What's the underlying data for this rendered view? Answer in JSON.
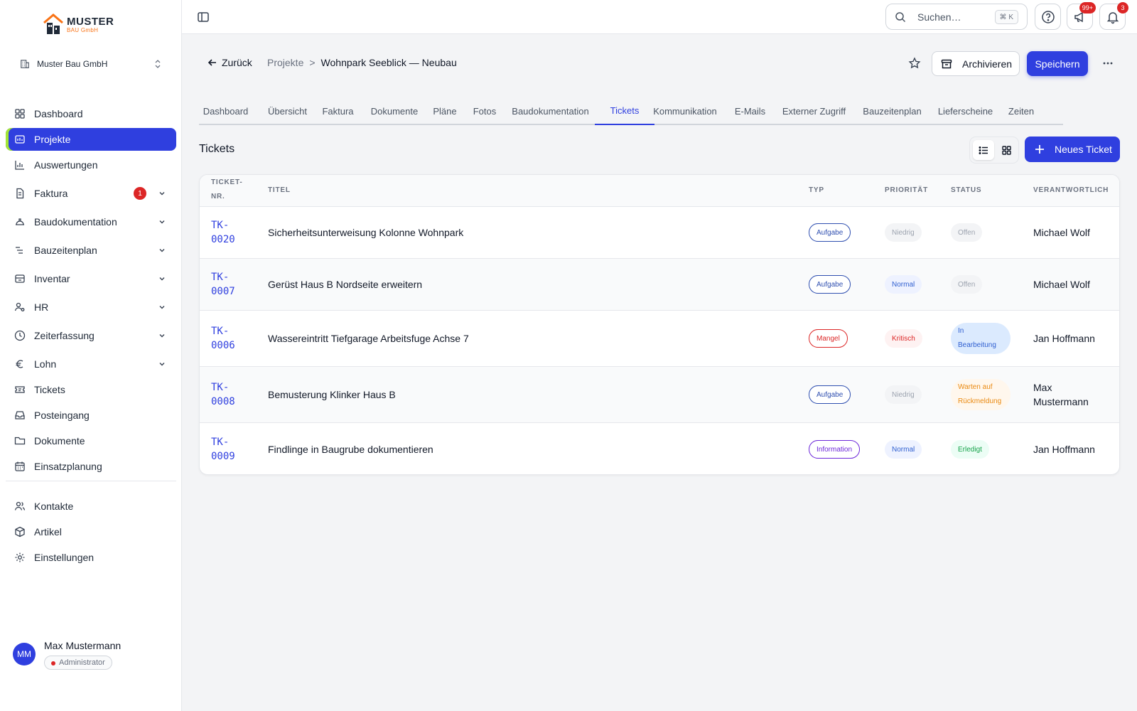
{
  "sidebar": {
    "logo": {
      "line1": "MUSTER",
      "line2": "BAU GmbH"
    },
    "company": "Muster Bau GmbH",
    "items": [
      {
        "label": "Dashboard",
        "icon": "grid-icon"
      },
      {
        "label": "Projekte",
        "icon": "project-icon",
        "active": true
      },
      {
        "label": "Auswertungen",
        "icon": "bar-chart-icon"
      },
      {
        "label": "Faktura",
        "icon": "document-icon",
        "badge": "1",
        "expandable": true
      },
      {
        "label": "Baudokumentation",
        "icon": "hardhat-icon",
        "expandable": true
      },
      {
        "label": "Bauzeitenplan",
        "icon": "gantt-icon",
        "expandable": true
      },
      {
        "label": "Inventar",
        "icon": "inventory-icon",
        "expandable": true
      },
      {
        "label": "HR",
        "icon": "user-gear-icon",
        "expandable": true
      },
      {
        "label": "Zeiterfassung",
        "icon": "clock-icon",
        "expandable": true
      },
      {
        "label": "Lohn",
        "icon": "euro-icon",
        "expandable": true
      },
      {
        "label": "Tickets",
        "icon": "ticket-icon"
      },
      {
        "label": "Posteingang",
        "icon": "inbox-icon"
      },
      {
        "label": "Dokumente",
        "icon": "folder-icon"
      },
      {
        "label": "Einsatzplanung",
        "icon": "calendar-icon"
      },
      {
        "label": "Kontakte",
        "icon": "users-icon"
      },
      {
        "label": "Artikel",
        "icon": "box-icon"
      },
      {
        "label": "Einstellungen",
        "icon": "gear-icon"
      }
    ],
    "user": {
      "initials": "MM",
      "name": "Max Mustermann",
      "role": "Administrator"
    }
  },
  "topbar": {
    "search_placeholder": "Suchen…",
    "search_shortcut": "⌘ K",
    "announcements_badge": "99+",
    "notifications_badge": "3"
  },
  "header": {
    "back_label": "Zurück",
    "breadcrumb": [
      "Projekte",
      "Wohnpark Seeblick — Neubau"
    ],
    "archive_label": "Archivieren",
    "save_label": "Speichern"
  },
  "tabs": [
    {
      "label": "Dashboard"
    },
    {
      "label": "Übersicht"
    },
    {
      "label": "Faktura"
    },
    {
      "label": "Dokumente"
    },
    {
      "label": "Pläne"
    },
    {
      "label": "Fotos"
    },
    {
      "label": "Baudokumentation"
    },
    {
      "label": "Tickets",
      "active": true
    },
    {
      "label": "Kommunikation"
    },
    {
      "label": "E-Mails"
    },
    {
      "label": "Externer Zugriff"
    },
    {
      "label": "Bauzeitenplan"
    },
    {
      "label": "Lieferscheine"
    },
    {
      "label": "Zeiten"
    }
  ],
  "section": {
    "title": "Tickets",
    "new_label": "Neues Ticket"
  },
  "table": {
    "columns": [
      "Ticket-Nr.",
      "Titel",
      "Typ",
      "Priorität",
      "Status",
      "Verantwortlich"
    ],
    "rows": [
      {
        "id": "TK-0020",
        "title": "Sicherheitsunterweisung Kolonne Wohnpark",
        "type": "Aufgabe",
        "priority": "Niedrig",
        "status": "Offen",
        "owner": "Michael Wolf"
      },
      {
        "id": "TK-0007",
        "title": "Gerüst Haus B Nordseite erweitern",
        "type": "Aufgabe",
        "priority": "Normal",
        "status": "Offen",
        "owner": "Michael Wolf"
      },
      {
        "id": "TK-0006",
        "title": "Wassereintritt Tiefgarage Arbeitsfuge Achse 7",
        "type": "Mangel",
        "priority": "Kritisch",
        "status": "In Bearbeitung",
        "owner": "Jan Hoffmann"
      },
      {
        "id": "TK-0008",
        "title": "Bemusterung Klinker Haus B",
        "type": "Aufgabe",
        "priority": "Niedrig",
        "status": "Warten auf Rückmeldung",
        "owner": "Max Mustermann"
      },
      {
        "id": "TK-0009",
        "title": "Findlinge in Baugrube dokumentieren",
        "type": "Information",
        "priority": "Normal",
        "status": "Erledigt",
        "owner": "Jan Hoffmann"
      }
    ]
  },
  "colors": {
    "accent": "#2f3fdf",
    "active_marker": "#a3e635",
    "danger": "#dc2626"
  }
}
